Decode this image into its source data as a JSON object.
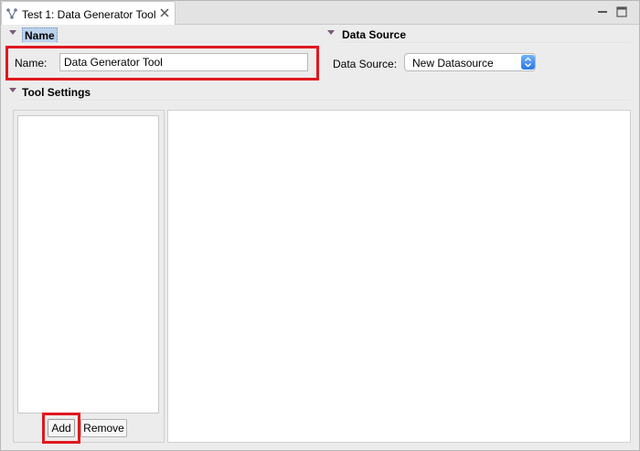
{
  "tab": {
    "title": "Test 1: Data Generator Tool",
    "icon": "tool-tree-icon",
    "close_icon": "close-icon"
  },
  "window_controls": {
    "minimize_icon": "minimize-icon",
    "maximize_icon": "maximize-icon"
  },
  "name_section": {
    "title": "Name",
    "label": "Name:",
    "value": "Data Generator Tool"
  },
  "datasource_section": {
    "title": "Data Source",
    "label": "Data Source:",
    "selected": "New Datasource"
  },
  "tool_settings": {
    "title": "Tool Settings",
    "add_label": "Add",
    "remove_label": "Remove"
  },
  "colors": {
    "highlight": "#e0181e",
    "select_button": "#2a78e4"
  }
}
